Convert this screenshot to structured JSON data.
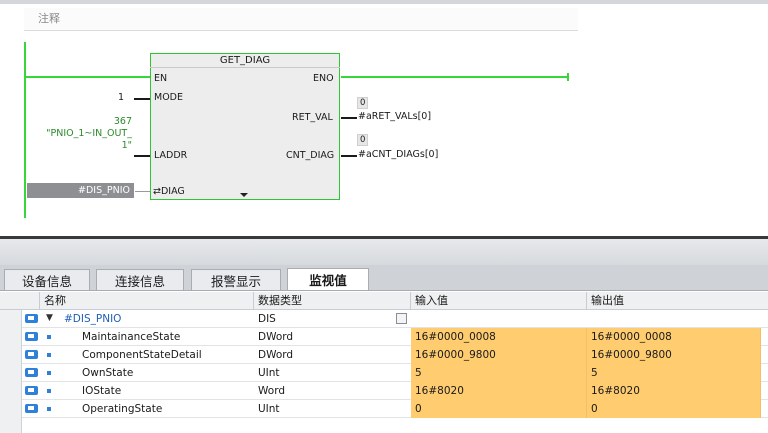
{
  "ladder": {
    "comment_label": "注释",
    "block": {
      "title": "GET_DIAG",
      "in_en": "EN",
      "out_eno": "ENO",
      "in_mode": "MODE",
      "in_laddr": "LADDR",
      "in_diag": "DIAG",
      "out_ret": "RET_VAL",
      "out_cnt": "CNT_DIAG",
      "diag_inout_symbol": "⇄"
    },
    "mode_value": "1",
    "laddr_value": "367",
    "laddr_name_1": "\"PNIO_1~IN_OUT_",
    "laddr_name_2": "1\"",
    "ret_val_live": "0",
    "ret_val_target": "#aRET_VALs[0]",
    "cnt_val_live": "0",
    "cnt_val_target": "#aCNT_DIAGs[0]",
    "diag_param": "#DIS_PNIO"
  },
  "panel": {
    "tabs": [
      {
        "label": "设备信息",
        "active": false
      },
      {
        "label": "连接信息",
        "active": false
      },
      {
        "label": "报警显示",
        "active": false
      },
      {
        "label": "监视值",
        "active": true
      }
    ],
    "columns": [
      "名称",
      "数据类型",
      "输入值",
      "输出值"
    ],
    "rows": [
      {
        "name": "#DIS_PNIO",
        "type": "DIS",
        "input": "",
        "output": "",
        "expanded": true,
        "level": 0
      },
      {
        "name": "MaintainanceState",
        "type": "DWord",
        "input": "16#0000_0008",
        "output": "16#0000_0008",
        "level": 1
      },
      {
        "name": "ComponentStateDetail",
        "type": "DWord",
        "input": "16#0000_9800",
        "output": "16#0000_9800",
        "level": 1
      },
      {
        "name": "OwnState",
        "type": "UInt",
        "input": "5",
        "output": "5",
        "level": 1
      },
      {
        "name": "IOState",
        "type": "Word",
        "input": "16#8020",
        "output": "16#8020",
        "level": 1
      },
      {
        "name": "OperatingState",
        "type": "UInt",
        "input": "0",
        "output": "0",
        "level": 1
      }
    ]
  },
  "colors": {
    "power_flow": "#39d63b",
    "monitor_value_bg": "#ffcd70",
    "tag_icon": "#2f80d8"
  },
  "icons": [
    "tag-icon",
    "expand-triangle-icon",
    "struct-type-icon",
    "member-bullet-icon"
  ]
}
